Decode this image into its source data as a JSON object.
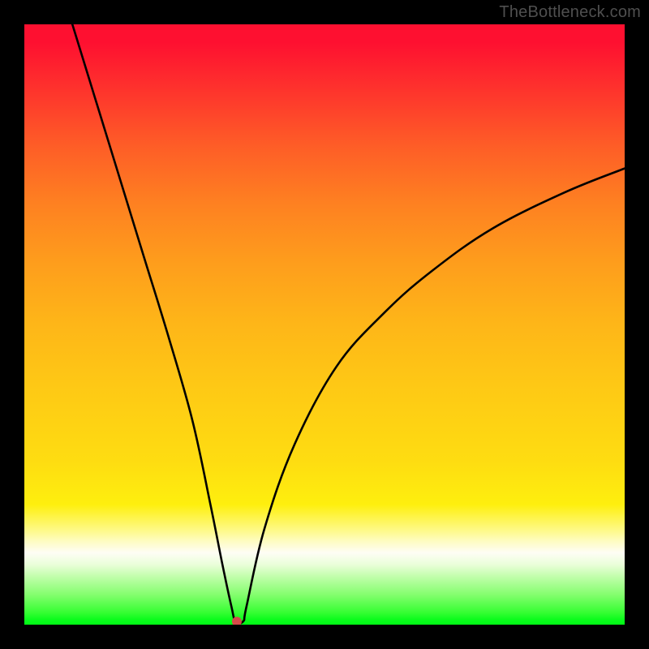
{
  "attribution": "TheBottleneck.com",
  "chart_data": {
    "type": "line",
    "title": "",
    "xlabel": "",
    "ylabel": "",
    "xlim": [
      0,
      100
    ],
    "ylim": [
      0,
      100
    ],
    "series": [
      {
        "name": "bottleneck-curve",
        "x": [
          8,
          12,
          16,
          20,
          24,
          28,
          31,
          33,
          34.5,
          35.2,
          36.5,
          37,
          40,
          45,
          52,
          60,
          68,
          78,
          90,
          100
        ],
        "values": [
          100,
          87,
          74,
          61,
          48,
          34,
          20,
          10,
          3,
          0.5,
          0.6,
          3,
          16,
          30,
          43,
          52,
          59,
          66,
          72,
          76
        ]
      }
    ],
    "marker": {
      "x": 35.4,
      "y": 0.5,
      "color": "#d74a4a",
      "radius": 6
    },
    "background_gradient": {
      "stops": [
        {
          "pos": 0,
          "color": "#fe1030"
        },
        {
          "pos": 50,
          "color": "#feb618"
        },
        {
          "pos": 84,
          "color": "#fefa8e"
        },
        {
          "pos": 100,
          "color": "#01fa16"
        }
      ]
    }
  }
}
